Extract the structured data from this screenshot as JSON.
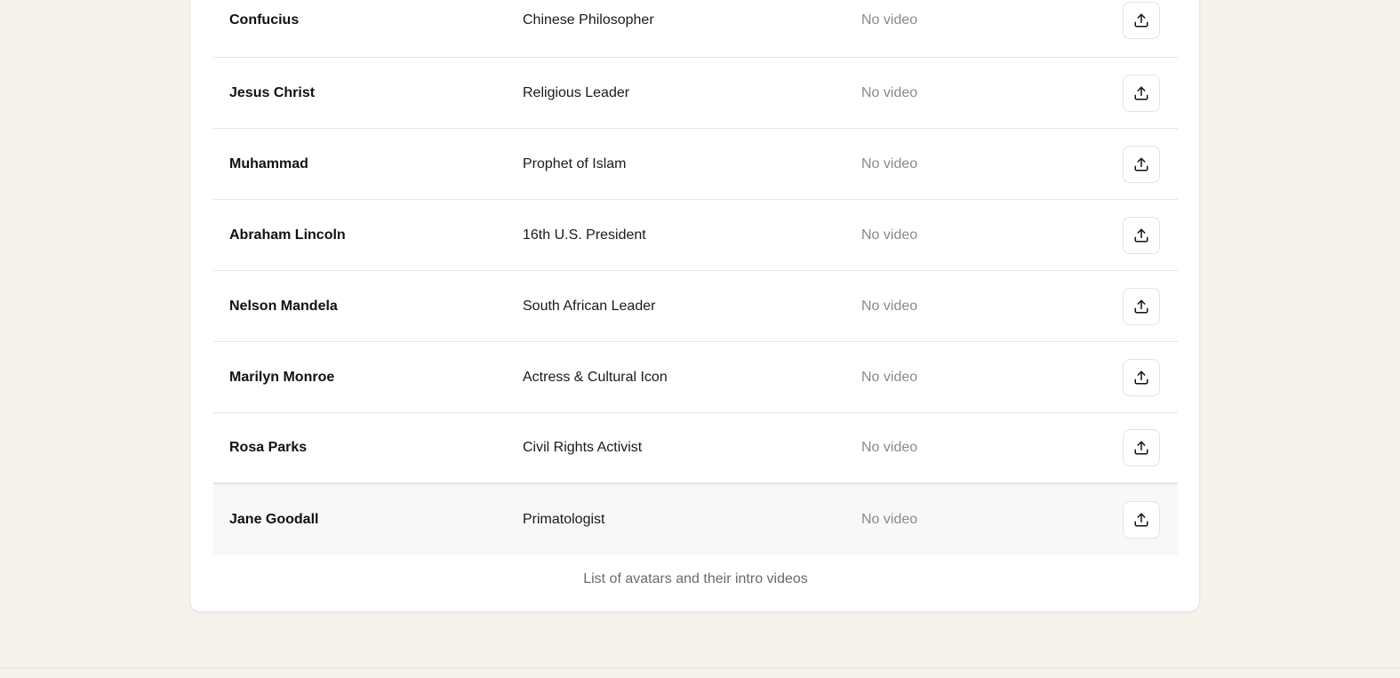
{
  "table": {
    "rows": [
      {
        "name": "Confucius",
        "role": "Chinese Philosopher",
        "video": "No video"
      },
      {
        "name": "Jesus Christ",
        "role": "Religious Leader",
        "video": "No video"
      },
      {
        "name": "Muhammad",
        "role": "Prophet of Islam",
        "video": "No video"
      },
      {
        "name": "Abraham Lincoln",
        "role": "16th U.S. President",
        "video": "No video"
      },
      {
        "name": "Nelson Mandela",
        "role": "South African Leader",
        "video": "No video"
      },
      {
        "name": "Marilyn Monroe",
        "role": "Actress & Cultural Icon",
        "video": "No video"
      },
      {
        "name": "Rosa Parks",
        "role": "Civil Rights Activist",
        "video": "No video"
      },
      {
        "name": "Jane Goodall",
        "role": "Primatologist",
        "video": "No video"
      }
    ],
    "caption": "List of avatars and their intro videos",
    "action_icon": "upload-icon"
  },
  "colors": {
    "page_background": "#f5f3ec",
    "card_background": "#ffffff",
    "muted_text": "#8a8a8a",
    "hover_row": "#f8f8f8"
  }
}
